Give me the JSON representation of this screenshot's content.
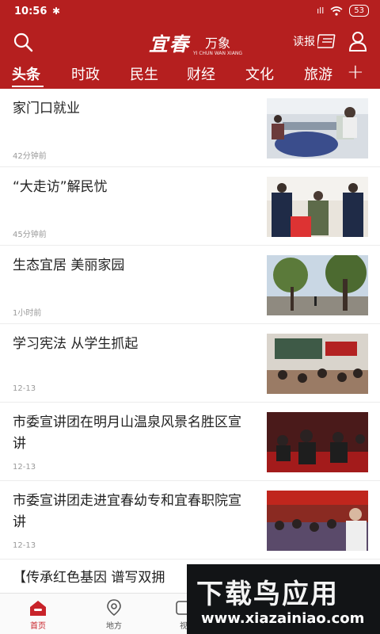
{
  "status": {
    "time": "10:56",
    "bluetooth": "✱",
    "signal": "ıll",
    "battery": "53"
  },
  "header": {
    "logo_main": "宜春",
    "logo_side": "万象",
    "logo_sub": "YI CHUN WAN XIANG",
    "read_label": "读报"
  },
  "tabs": [
    "头条",
    "时政",
    "民生",
    "财经",
    "文化",
    "旅游"
  ],
  "tab_more": "+",
  "articles": [
    {
      "title": "家门口就业",
      "time": "42分钟前"
    },
    {
      "title": "“大走访”解民忧",
      "time": "45分钟前"
    },
    {
      "title": "生态宜居 美丽家园",
      "time": "1小时前"
    },
    {
      "title": "学习宪法 从学生抓起",
      "time": "12-13"
    },
    {
      "title": "市委宣讲团在明月山温泉风景名胜区宣讲",
      "time": "12-13"
    },
    {
      "title": "市委宣讲团走进宜春幼专和宜春职院宣讲",
      "time": "12-13"
    },
    {
      "title": "【传承红色基因 谱写双拥",
      "time": ""
    }
  ],
  "bottom_nav": [
    {
      "label": "首页",
      "icon": "home-icon"
    },
    {
      "label": "地方",
      "icon": "location-icon"
    },
    {
      "label": "视",
      "icon": "video-icon"
    }
  ],
  "watermark": {
    "brand": "下载鸟应用",
    "url": "www.xiazainiao.com"
  },
  "colors": {
    "brand": "#b51f1f",
    "accent": "#c8232a"
  }
}
